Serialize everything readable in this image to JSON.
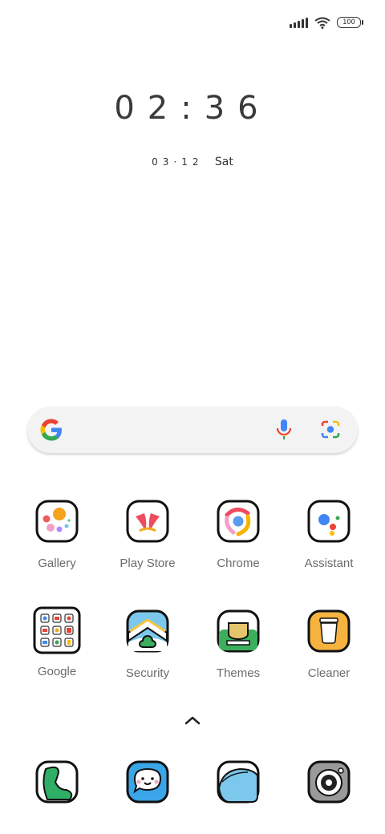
{
  "status_bar": {
    "signal_icon": "signal-bars-icon",
    "wifi_icon": "wifi-icon",
    "battery_level": "100"
  },
  "lock_clock": {
    "time": "02:36",
    "date": "03·12",
    "weekday": "Sat"
  },
  "search_bar": {
    "logo": "google-g-logo",
    "mic_icon": "microphone-icon",
    "lens_icon": "google-lens-icon"
  },
  "apps_row1": [
    {
      "label": "Gallery"
    },
    {
      "label": "Play Store"
    },
    {
      "label": "Chrome"
    },
    {
      "label": "Assistant"
    }
  ],
  "apps_row2": [
    {
      "label": "Google"
    },
    {
      "label": "Security"
    },
    {
      "label": "Themes"
    },
    {
      "label": "Cleaner"
    }
  ],
  "dock": [
    {
      "icon": "phone-icon"
    },
    {
      "icon": "messages-icon"
    },
    {
      "icon": "browser-icon"
    },
    {
      "icon": "camera-icon"
    }
  ],
  "app_drawer_hint": "chevron-up-icon"
}
